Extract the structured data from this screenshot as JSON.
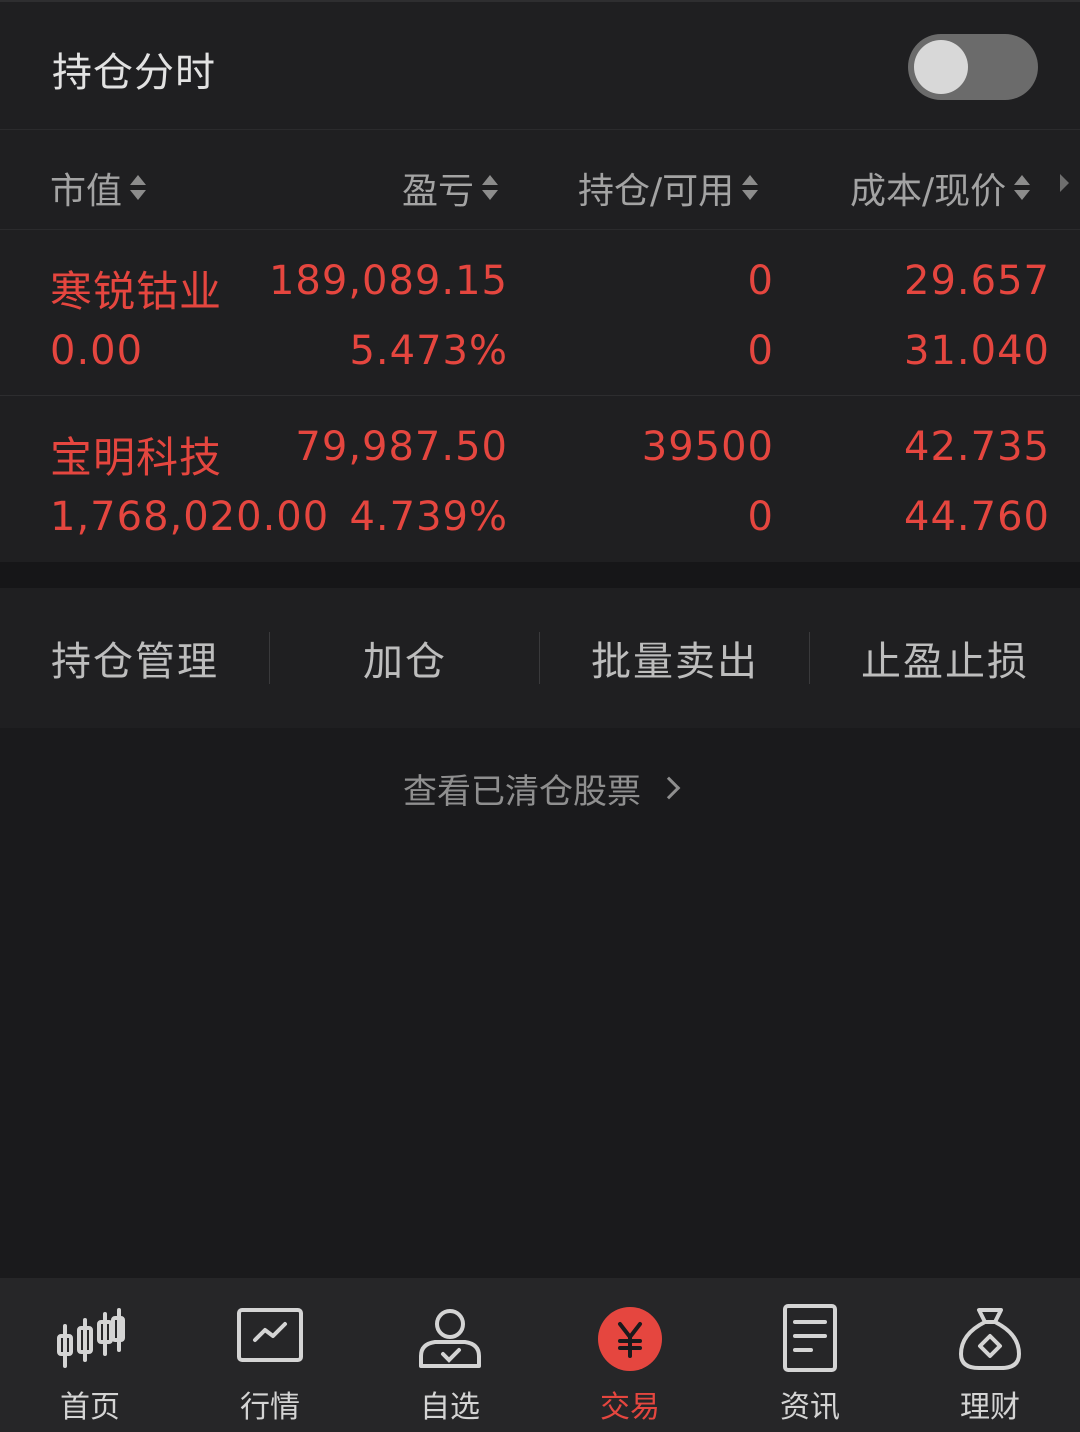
{
  "header": {
    "title": "持仓分时",
    "toggle_on": false
  },
  "columns": [
    {
      "label": "市值"
    },
    {
      "label": "盈亏"
    },
    {
      "label": "持仓/可用"
    },
    {
      "label": "成本/现价"
    }
  ],
  "holdings": [
    {
      "name": "寒锐钴业",
      "market_value": "0.00",
      "pnl": "189,089.15",
      "pnl_pct": "5.473%",
      "position": "0",
      "available": "0",
      "cost": "29.657",
      "price": "31.040"
    },
    {
      "name": "宝明科技",
      "market_value": "1,768,020.00",
      "pnl": "79,987.50",
      "pnl_pct": "4.739%",
      "position": "39500",
      "available": "0",
      "cost": "42.735",
      "price": "44.760"
    }
  ],
  "actions": [
    {
      "label": "持仓管理"
    },
    {
      "label": "加仓"
    },
    {
      "label": "批量卖出"
    },
    {
      "label": "止盈止损"
    }
  ],
  "cleared_link": "查看已清仓股票",
  "tabs": [
    {
      "label": "首页",
      "icon": "candlestick-icon"
    },
    {
      "label": "行情",
      "icon": "market-chart-icon"
    },
    {
      "label": "自选",
      "icon": "user-check-icon"
    },
    {
      "label": "交易",
      "icon": "yen-icon",
      "active": true
    },
    {
      "label": "资讯",
      "icon": "document-icon"
    },
    {
      "label": "理财",
      "icon": "money-bag-icon"
    }
  ],
  "colors": {
    "up_red": "#e5463f",
    "background": "#1a1a1c"
  }
}
